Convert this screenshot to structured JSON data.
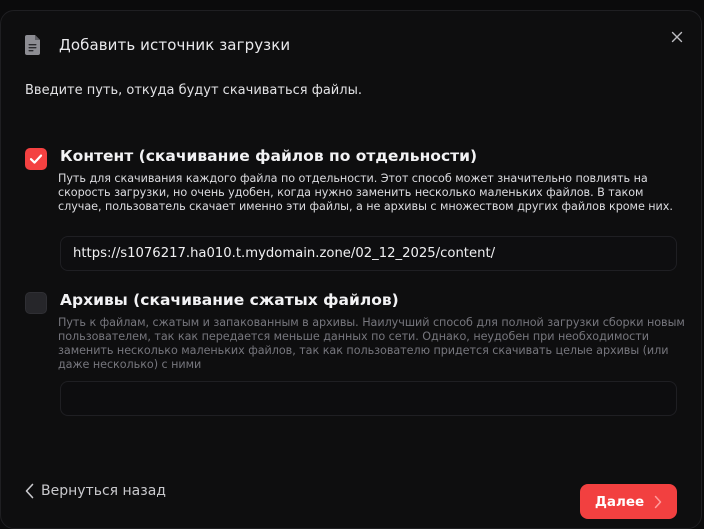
{
  "dialog": {
    "title": "Добавить источник загрузки",
    "intro": "Введите путь, откуда будут скачиваться файлы.",
    "icons": {
      "header": "document-icon",
      "close": "close-icon"
    }
  },
  "options": {
    "content": {
      "checked": true,
      "title": "Контент (скачивание файлов по отдельности)",
      "description": "Путь для скачивания каждого файла по отдельности. Этот способ может значительно повлиять на скорость загрузки, но очень удобен, когда нужно заменить несколько маленьких файлов. В таком случае, пользователь скачает именно эти файлы, а не архивы с множеством других файлов кроме них.",
      "value": "https://s1076217.ha010.t.mydomain.zone/02_12_2025/content/"
    },
    "archives": {
      "checked": false,
      "title": "Архивы (скачивание сжатых файлов)",
      "description": "Путь к файлам, сжатым и запакованным в архивы. Наилучший способ для полной загрузки сборки новым пользователем, так как передается меньше данных по сети. Однако, неудобен при необходимости заменить несколько маленьких файлов, так как пользователю придется скачивать целые архивы (или даже несколько) с ними",
      "value": ""
    }
  },
  "footer": {
    "back_label": "Вернуться назад",
    "next_label": "Далее"
  },
  "colors": {
    "accent": "#f24040",
    "background": "#0e0e0f"
  }
}
